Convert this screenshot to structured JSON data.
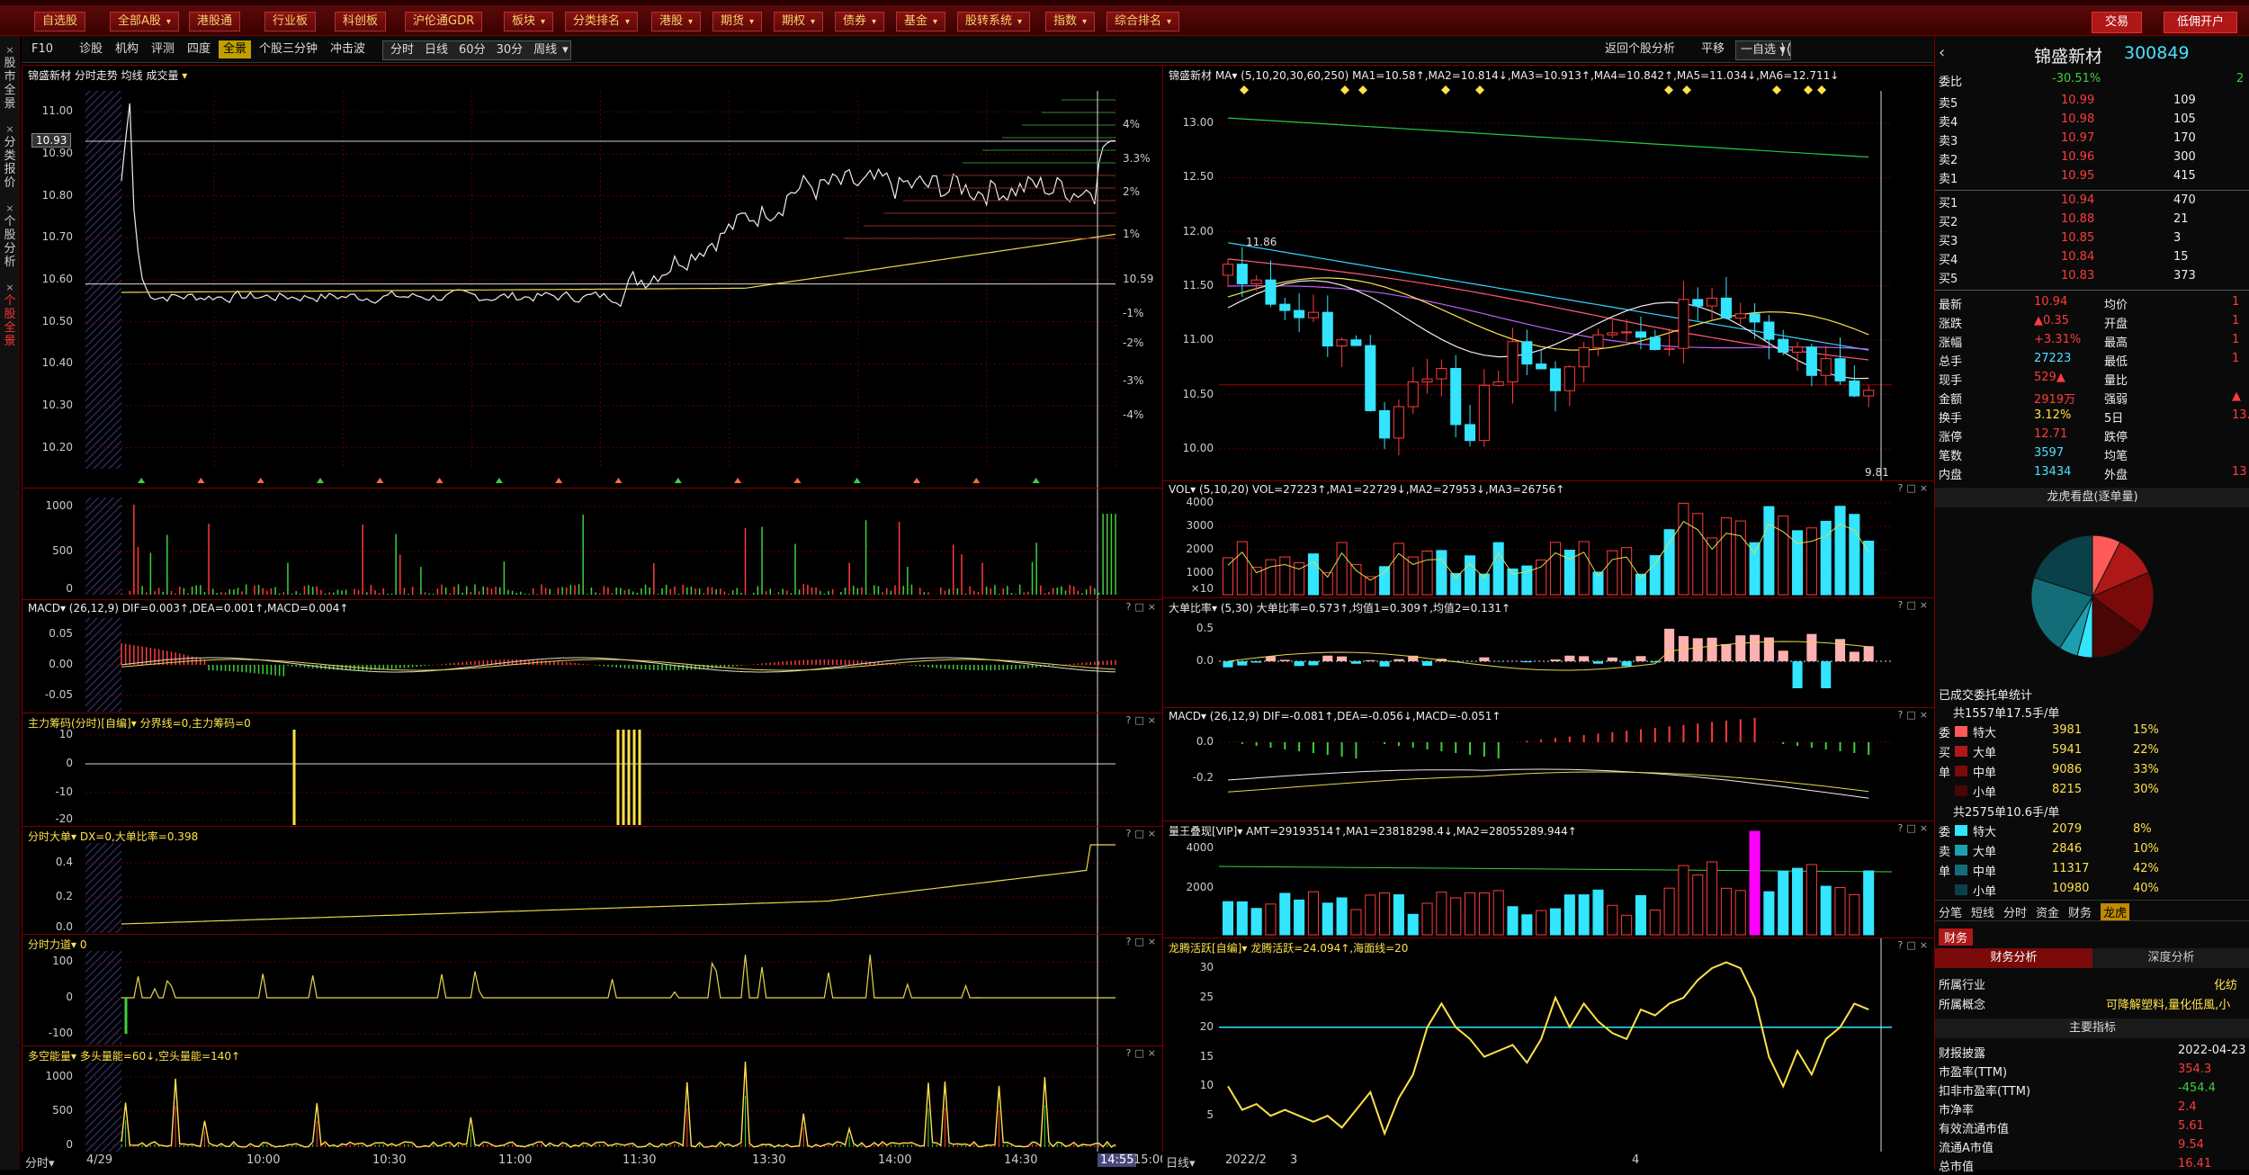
{
  "topbar": {
    "buttons": [
      "自选股",
      "全部A股",
      "港股通",
      "行业板",
      "科创板",
      "沪伦通GDR",
      "板块",
      "分类排名",
      "港股",
      "期货",
      "期权",
      "债券",
      "基金",
      "股转系统",
      "指数",
      "综合排名"
    ],
    "trade_label": "交易",
    "open_account_label": "低佣开户"
  },
  "subbar": {
    "items": [
      "F10",
      "诊股",
      "机构",
      "评测",
      "四度",
      "全景",
      "个股三分钟",
      "冲击波"
    ],
    "periods": [
      "分时",
      "日线",
      "60分",
      "30分",
      "周线"
    ],
    "right": {
      "back": "返回个股分析",
      "flat": "平移",
      "select": "一自选"
    }
  },
  "left_tabs": [
    "股市全景",
    "分类报价",
    "个股分析",
    "个股全景"
  ],
  "intraday": {
    "title": "锦盛新材 分时走势 均线 成交量",
    "price_ticks": [
      "11.00",
      "10.90",
      "10.80",
      "10.70",
      "10.60",
      "10.50",
      "10.40",
      "10.30",
      "10.20"
    ],
    "price_label": "10.93",
    "right_pct_ticks": [
      "4%",
      "3.3%",
      "2%",
      "1%",
      "10.59",
      "-1%",
      "-2%",
      "-3%",
      "-4%"
    ],
    "vol_ticks": [
      "1000",
      "500",
      "0"
    ],
    "macd_title": "MACD▾ (26,12,9) DIF=0.003↑,DEA=0.001↑,MACD=0.004↑",
    "macd_ticks": [
      "0.05",
      "0.00",
      "-0.05"
    ],
    "zlcm_title": "主力筹码(分时)[自编]▾ 分界线=0,主力筹码=0",
    "zlcm_ticks": [
      "10",
      "0",
      "-10",
      "-20"
    ],
    "fsdd_title": "分时大单▾ DX=0,大单比率=0.398",
    "fsdd_ticks": [
      "0.4",
      "0.2",
      "0.0"
    ],
    "fsld_title": "分时力道▾ 0",
    "fsld_ticks": [
      "100",
      "0",
      "-100"
    ],
    "dknl_title": "多空能量▾ 多头量能=60↓,空头量能=140↑",
    "dknl_ticks": [
      "1000",
      "500",
      "0"
    ],
    "x_ticks": [
      "4/29",
      "10:00",
      "10:30",
      "11:00",
      "11:30",
      "13:30",
      "14:00",
      "14:30",
      "14:55",
      "15:00"
    ],
    "x_label": "分时▾"
  },
  "daily": {
    "title": "锦盛新材 MA▾ (5,10,20,30,60,250) MA1=10.58↑,MA2=10.814↓,MA3=10.913↑,MA4=10.842↑,MA5=11.034↓,MA6=12.711↓",
    "price_ticks": [
      "13.00",
      "12.50",
      "12.00",
      "11.50",
      "11.00",
      "10.50",
      "10.00"
    ],
    "high_label": "11.86",
    "low_label": "9.81",
    "vol_title": "VOL▾ (5,10,20) VOL=27223↑,MA1=22729↓,MA2=27953↓,MA3=26756↑",
    "vol_ticks": [
      "4000",
      "3000",
      "2000",
      "1000",
      "×10"
    ],
    "ddbl_title": "大单比率▾ (5,30) 大单比率=0.573↑,均值1=0.309↑,均值2=0.131↑",
    "ddbl_ticks": [
      "0.5",
      "0.0"
    ],
    "macd_title": "MACD▾ (26,12,9) DIF=-0.081↑,DEA=-0.056↓,MACD=-0.051↑",
    "macd_ticks": [
      "0.0",
      "-0.2"
    ],
    "lwdx_title": "量王叠现[VIP]▾ AMT=29193514↑,MA1=23818298.4↓,MA2=28055289.944↑",
    "lwdx_ticks": [
      "4000",
      "2000"
    ],
    "lthy_title": "龙腾活跃[自编]▾ 龙腾活跃=24.094↑,海面线=20",
    "lthy_ticks": [
      "30",
      "25",
      "20",
      "15",
      "10",
      "5"
    ],
    "x_ticks": [
      "2022/2",
      "3",
      "4"
    ],
    "x_label": "日线▾"
  },
  "right": {
    "stock_name": "锦盛新材",
    "stock_code": "300849",
    "webi_label": "委比",
    "webi_value": "-30.51%",
    "webi_cha": "2",
    "sell": [
      [
        "卖5",
        "10.99",
        "109"
      ],
      [
        "卖4",
        "10.98",
        "105"
      ],
      [
        "卖3",
        "10.97",
        "170"
      ],
      [
        "卖2",
        "10.96",
        "300"
      ],
      [
        "卖1",
        "10.95",
        "415"
      ]
    ],
    "buy": [
      [
        "买1",
        "10.94",
        "470"
      ],
      [
        "买2",
        "10.88",
        "21"
      ],
      [
        "买3",
        "10.85",
        "3"
      ],
      [
        "买4",
        "10.84",
        "15"
      ],
      [
        "买5",
        "10.83",
        "373"
      ]
    ],
    "quote": [
      [
        "最新",
        "10.94",
        "均价",
        "1"
      ],
      [
        "涨跌",
        "▲0.35",
        "开盘",
        "1"
      ],
      [
        "涨幅",
        "+3.31%",
        "最高",
        "1"
      ],
      [
        "总手",
        "27223",
        "最低",
        "1"
      ],
      [
        "现手",
        "529▲",
        "量比",
        ""
      ],
      [
        "金额",
        "2919万",
        "强弱",
        "▲"
      ],
      [
        "换手",
        "3.12%",
        "5日",
        "13."
      ],
      [
        "涨停",
        "12.71",
        "跌停",
        ""
      ],
      [
        "笔数",
        "3597",
        "均笔",
        ""
      ],
      [
        "内盘",
        "13434",
        "外盘",
        "13"
      ]
    ],
    "lhkp_title": "龙虎看盘(逐单量)",
    "entrusted_title": "已成交委托单统计",
    "buy_summary": "共1557单17.5手/单",
    "sell_summary": "共2575单10.6手/单",
    "buy_rows": [
      [
        "特大",
        "3981",
        "15%"
      ],
      [
        "大单",
        "5941",
        "22%"
      ],
      [
        "中单",
        "9086",
        "33%"
      ],
      [
        "小单",
        "8215",
        "30%"
      ]
    ],
    "sell_rows": [
      [
        "特大",
        "2079",
        "8%"
      ],
      [
        "大单",
        "2846",
        "10%"
      ],
      [
        "中单",
        "11317",
        "42%"
      ],
      [
        "小单",
        "10980",
        "40%"
      ]
    ],
    "side_labels_buy": [
      "委",
      "买",
      "单"
    ],
    "side_labels_sell": [
      "委",
      "卖",
      "单"
    ],
    "tabs": [
      "分笔",
      "短线",
      "分时",
      "资金",
      "财务",
      "龙虎"
    ],
    "fin_tab": "财务",
    "fin_sub_tabs": [
      "财务分析",
      "深度分析"
    ],
    "fin_rows": [
      [
        "所属行业",
        "化纺"
      ],
      [
        "所属概念",
        "可降解塑料,量化低風,小"
      ]
    ],
    "main_indicators": "主要指标",
    "indicators": [
      [
        "财报披露",
        "2022-04-23"
      ],
      [
        "市盈率(TTM)",
        "354.3"
      ],
      [
        "扣非市盈率(TTM)",
        "-454.4"
      ],
      [
        "市净率",
        "2.4"
      ],
      [
        "有效流通市值",
        "5.61"
      ],
      [
        "流通A市值",
        "9.54"
      ],
      [
        "总市值",
        "16.41"
      ]
    ]
  },
  "colors": {
    "up": "#ff3b3b",
    "down": "#3bd13b",
    "cyan": "#33e5ff",
    "yellow": "#ffe24a",
    "grid": "#6a0000"
  }
}
